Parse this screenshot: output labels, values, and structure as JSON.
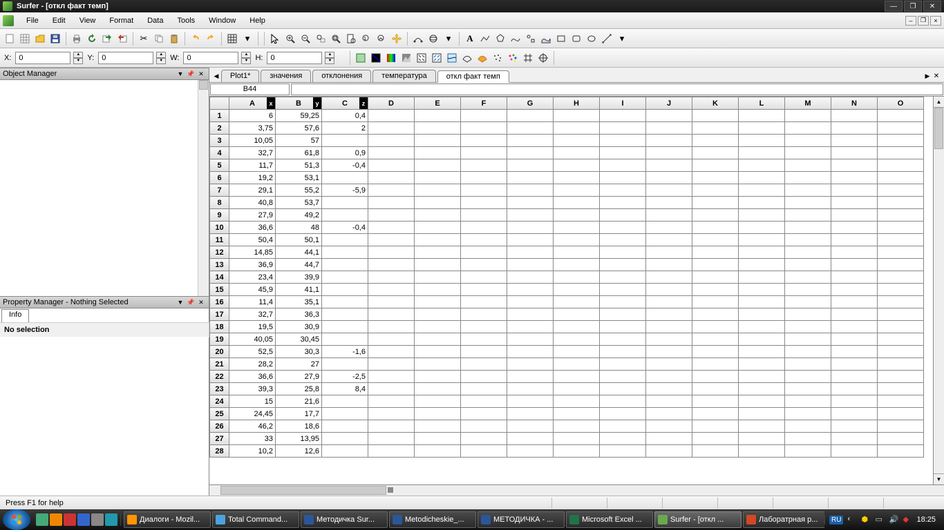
{
  "window": {
    "title": "Surfer - [откл факт темп]"
  },
  "menu": {
    "items": [
      "File",
      "Edit",
      "View",
      "Format",
      "Data",
      "Tools",
      "Window",
      "Help"
    ]
  },
  "coords": {
    "x_label": "X:",
    "x": "0",
    "y_label": "Y:",
    "y": "0",
    "w_label": "W:",
    "w": "0",
    "h_label": "H:",
    "h": "0"
  },
  "object_manager": {
    "title": "Object Manager"
  },
  "property_manager": {
    "title": "Property Manager - Nothing Selected",
    "tab": "Info",
    "body": "No selection"
  },
  "tabs": {
    "items": [
      "Plot1*",
      "значения",
      "отклонения",
      "температура",
      "откл факт темп"
    ],
    "active": 4
  },
  "cellref": "B44",
  "columns": [
    "A",
    "B",
    "C",
    "D",
    "E",
    "F",
    "G",
    "H",
    "I",
    "J",
    "K",
    "L",
    "M",
    "N",
    "O"
  ],
  "axis_badges": {
    "A": "x",
    "B": "y",
    "C": "z"
  },
  "rows": [
    {
      "n": 1,
      "A": "6",
      "B": "59,25",
      "C": "0,4"
    },
    {
      "n": 2,
      "A": "3,75",
      "B": "57,6",
      "C": "2"
    },
    {
      "n": 3,
      "A": "10,05",
      "B": "57",
      "C": ""
    },
    {
      "n": 4,
      "A": "32,7",
      "B": "61,8",
      "C": "0,9"
    },
    {
      "n": 5,
      "A": "11,7",
      "B": "51,3",
      "C": "-0,4"
    },
    {
      "n": 6,
      "A": "19,2",
      "B": "53,1",
      "C": ""
    },
    {
      "n": 7,
      "A": "29,1",
      "B": "55,2",
      "C": "-5,9"
    },
    {
      "n": 8,
      "A": "40,8",
      "B": "53,7",
      "C": ""
    },
    {
      "n": 9,
      "A": "27,9",
      "B": "49,2",
      "C": ""
    },
    {
      "n": 10,
      "A": "36,6",
      "B": "48",
      "C": "-0,4"
    },
    {
      "n": 11,
      "A": "50,4",
      "B": "50,1",
      "C": ""
    },
    {
      "n": 12,
      "A": "14,85",
      "B": "44,1",
      "C": ""
    },
    {
      "n": 13,
      "A": "36,9",
      "B": "44,7",
      "C": ""
    },
    {
      "n": 14,
      "A": "23,4",
      "B": "39,9",
      "C": ""
    },
    {
      "n": 15,
      "A": "45,9",
      "B": "41,1",
      "C": ""
    },
    {
      "n": 16,
      "A": "11,4",
      "B": "35,1",
      "C": ""
    },
    {
      "n": 17,
      "A": "32,7",
      "B": "36,3",
      "C": ""
    },
    {
      "n": 18,
      "A": "19,5",
      "B": "30,9",
      "C": ""
    },
    {
      "n": 19,
      "A": "40,05",
      "B": "30,45",
      "C": ""
    },
    {
      "n": 20,
      "A": "52,5",
      "B": "30,3",
      "C": "-1,6"
    },
    {
      "n": 21,
      "A": "28,2",
      "B": "27",
      "C": ""
    },
    {
      "n": 22,
      "A": "36,6",
      "B": "27,9",
      "C": "-2,5"
    },
    {
      "n": 23,
      "A": "39,3",
      "B": "25,8",
      "C": "8,4"
    },
    {
      "n": 24,
      "A": "15",
      "B": "21,6",
      "C": ""
    },
    {
      "n": 25,
      "A": "24,45",
      "B": "17,7",
      "C": ""
    },
    {
      "n": 26,
      "A": "46,2",
      "B": "18,6",
      "C": ""
    },
    {
      "n": 27,
      "A": "33",
      "B": "13,95",
      "C": ""
    },
    {
      "n": 28,
      "A": "10,2",
      "B": "12,6",
      "C": ""
    }
  ],
  "status": {
    "help": "Press F1 for help"
  },
  "taskbar": {
    "tasks": [
      {
        "label": "Диалоги - Mozil...",
        "color": "#ff9500"
      },
      {
        "label": "Total Command...",
        "color": "#4aa3df"
      },
      {
        "label": "Методичка Sur...",
        "color": "#2b579a"
      },
      {
        "label": "Metodicheskie_...",
        "color": "#2b579a"
      },
      {
        "label": "МЕТОДИЧКА - ...",
        "color": "#2b579a"
      },
      {
        "label": "Microsoft Excel ...",
        "color": "#217346"
      },
      {
        "label": "Surfer - [откл ...",
        "color": "#6aa84f",
        "active": true
      },
      {
        "label": "Лаборатрная р...",
        "color": "#d24726"
      }
    ],
    "lang": "RU",
    "clock": "18:25"
  }
}
